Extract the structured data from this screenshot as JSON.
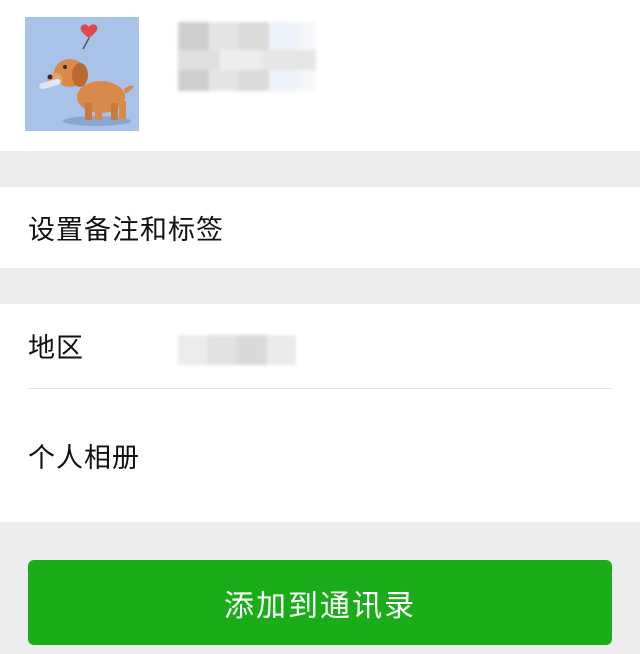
{
  "profile": {
    "avatar_icon": "dog-with-heart-avatar",
    "name_redacted": true
  },
  "remark_row": {
    "label": "设置备注和标签"
  },
  "region_row": {
    "label": "地区",
    "value_redacted": true
  },
  "album_row": {
    "label": "个人相册"
  },
  "add_button": {
    "label": "添加到通讯录",
    "color": "#1aad19"
  },
  "colors": {
    "background": "#ededed",
    "card": "#ffffff"
  }
}
